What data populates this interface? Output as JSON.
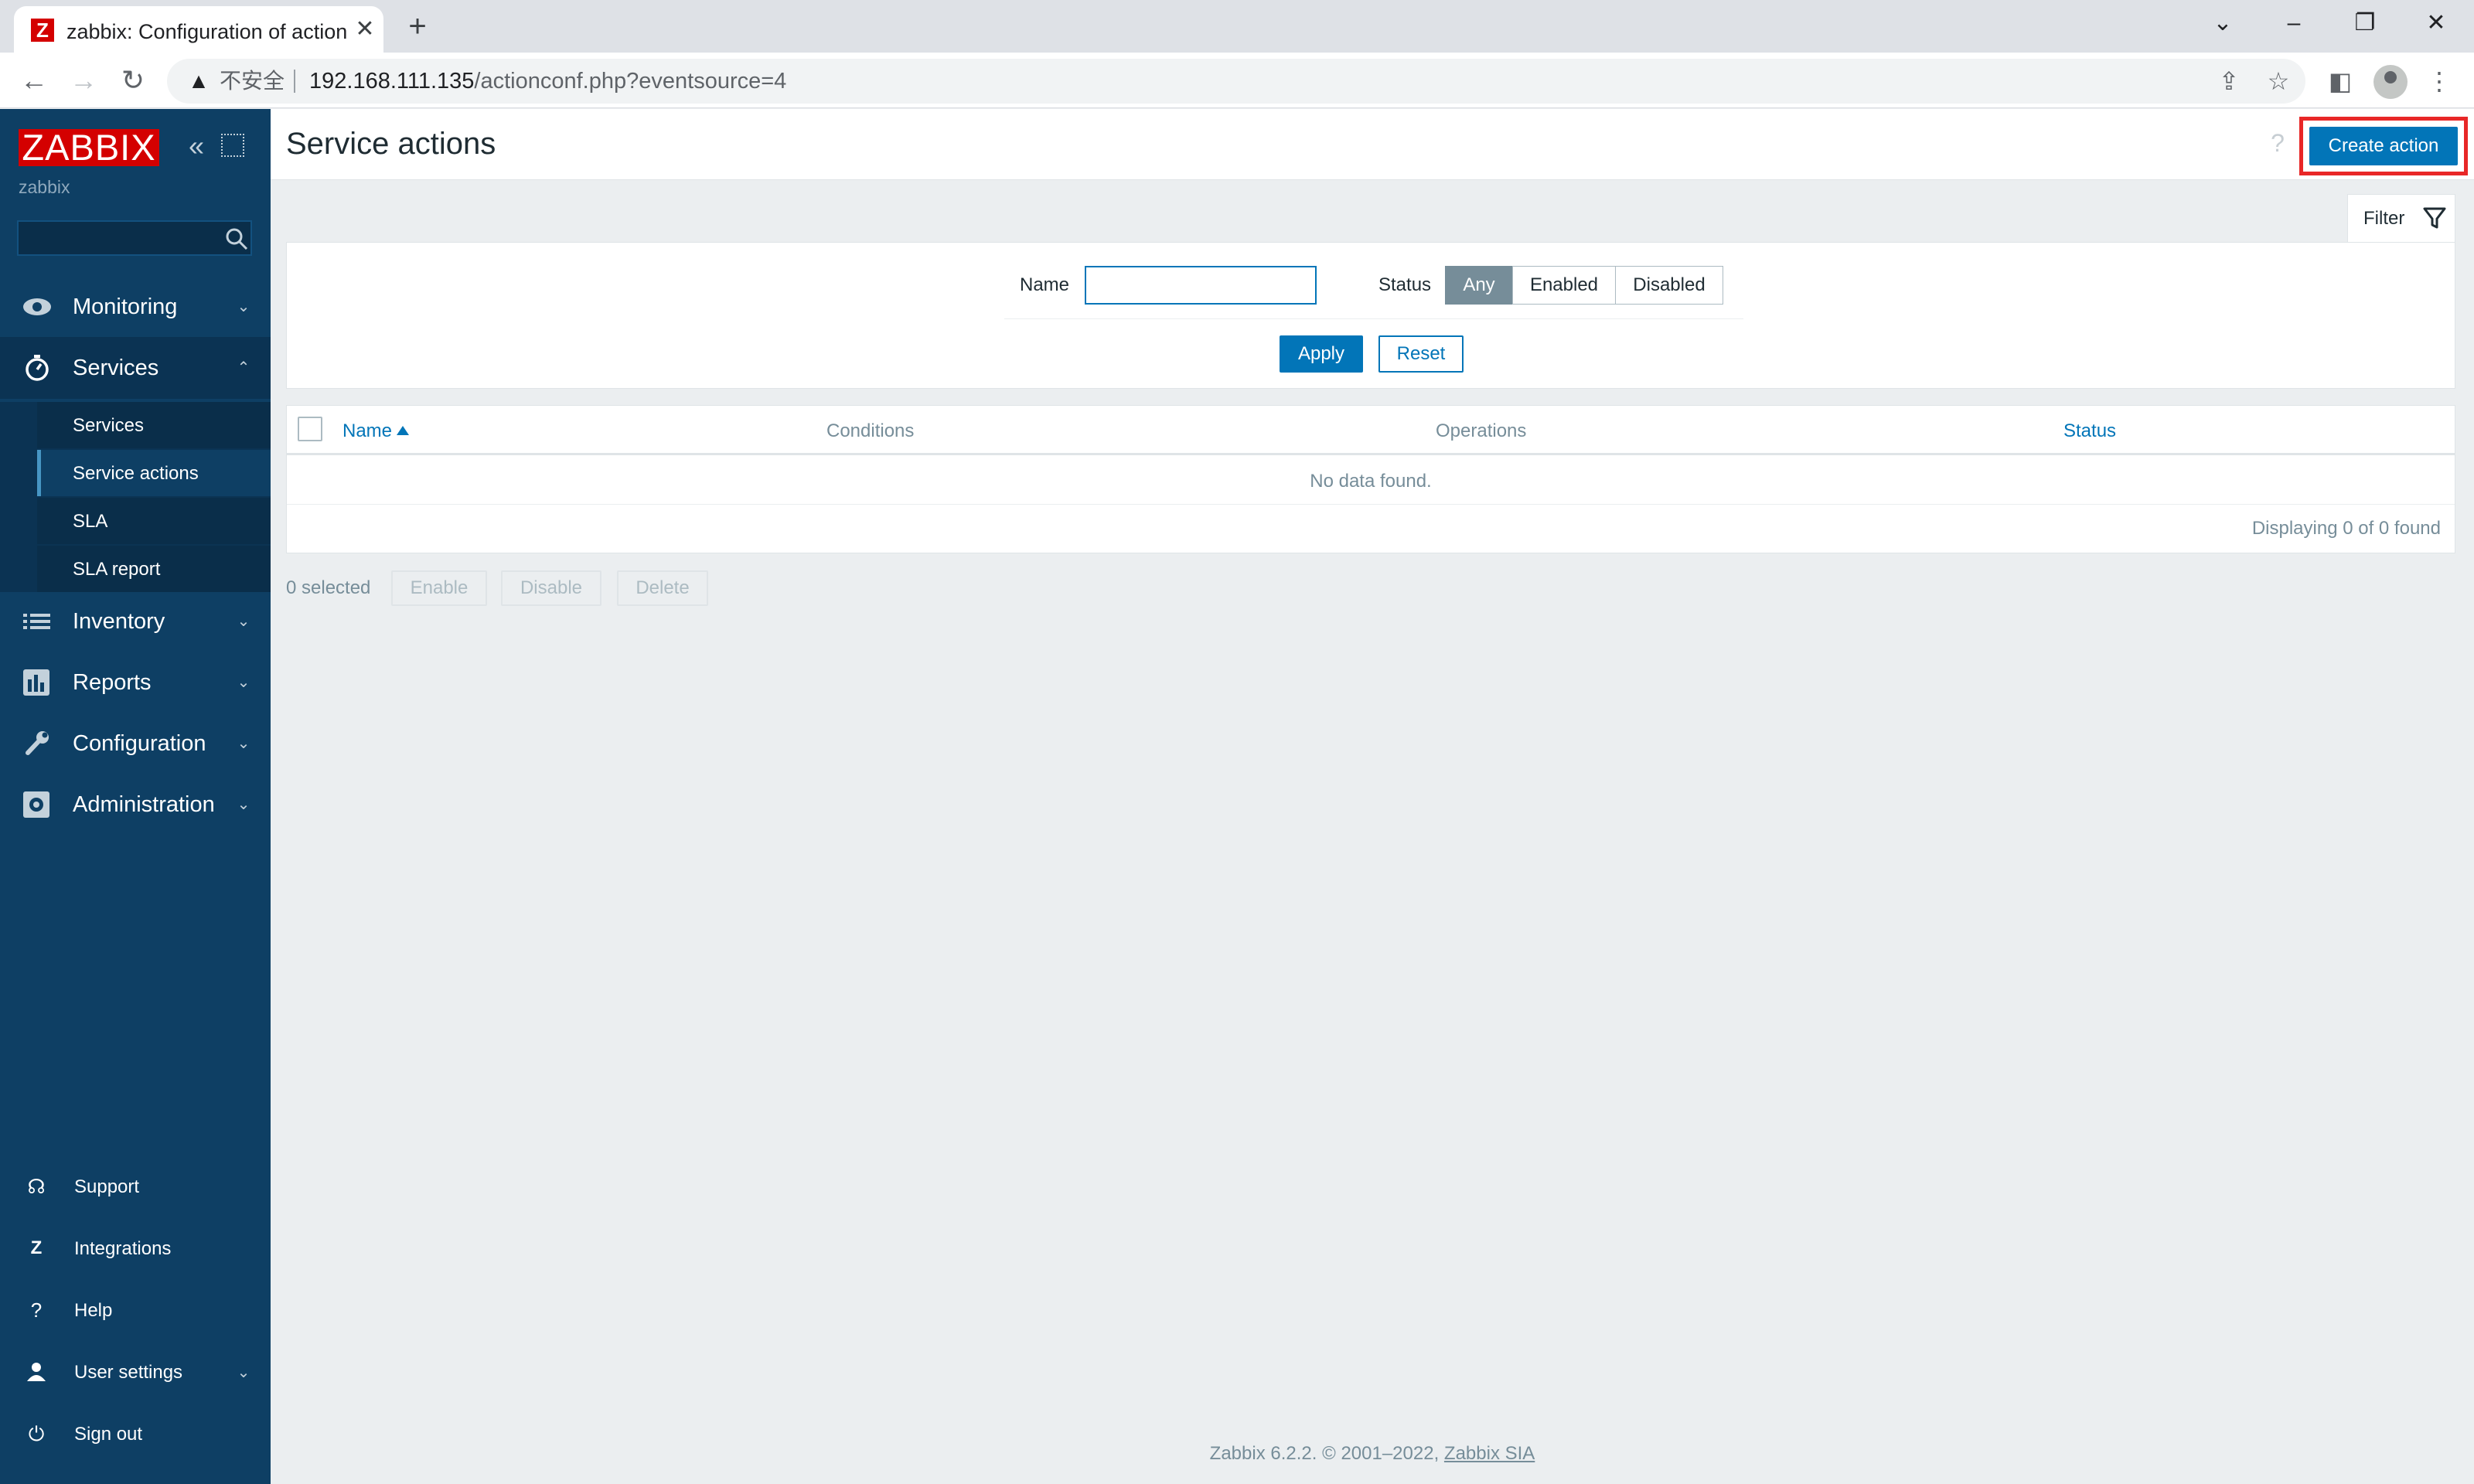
{
  "browser": {
    "tab_title": "zabbix: Configuration of action",
    "tab_favicon": "Z",
    "url_insecure": "不安全",
    "url_host": "192.168.111.135",
    "url_path": "/actionconf.php?eventsource=4"
  },
  "sidebar": {
    "logo": "ZABBIX",
    "server_name": "zabbix",
    "search_placeholder": "",
    "menu": [
      {
        "label": "Monitoring",
        "icon": "eye-icon"
      },
      {
        "label": "Services",
        "icon": "stopwatch-icon"
      },
      {
        "label": "Inventory",
        "icon": "list-icon"
      },
      {
        "label": "Reports",
        "icon": "bar-chart-icon"
      },
      {
        "label": "Configuration",
        "icon": "wrench-icon"
      },
      {
        "label": "Administration",
        "icon": "gear-icon"
      }
    ],
    "services_submenu": [
      "Services",
      "Service actions",
      "SLA",
      "SLA report"
    ],
    "utility": [
      {
        "label": "Support",
        "icon": "headset-icon"
      },
      {
        "label": "Integrations",
        "icon": "zabbix-z-icon"
      },
      {
        "label": "Help",
        "icon": "question-icon"
      },
      {
        "label": "User settings",
        "icon": "user-icon"
      },
      {
        "label": "Sign out",
        "icon": "power-icon"
      }
    ]
  },
  "header": {
    "title": "Service actions",
    "help": "?",
    "create_button": "Create action"
  },
  "filter": {
    "tab_label": "Filter",
    "name_label": "Name",
    "name_value": "",
    "status_label": "Status",
    "status_options": [
      "Any",
      "Enabled",
      "Disabled"
    ],
    "status_selected": "Any",
    "apply": "Apply",
    "reset": "Reset"
  },
  "table": {
    "columns": [
      "Name",
      "Conditions",
      "Operations",
      "Status"
    ],
    "sorted_by": "Name",
    "empty_text": "No data found.",
    "displaying": "Displaying 0 of 0 found"
  },
  "mass_actions": {
    "selected": "0 selected",
    "buttons": [
      "Enable",
      "Disable",
      "Delete"
    ]
  },
  "footer": {
    "version_text": "Zabbix 6.2.2. © 2001–2022,",
    "company_link": "Zabbix SIA"
  },
  "colors": {
    "sidebar_bg": "#0e3f64",
    "accent_blue": "#0275b8",
    "logo_red": "#d40000",
    "highlight_red": "#e82727",
    "page_bg": "#ebeef0"
  }
}
